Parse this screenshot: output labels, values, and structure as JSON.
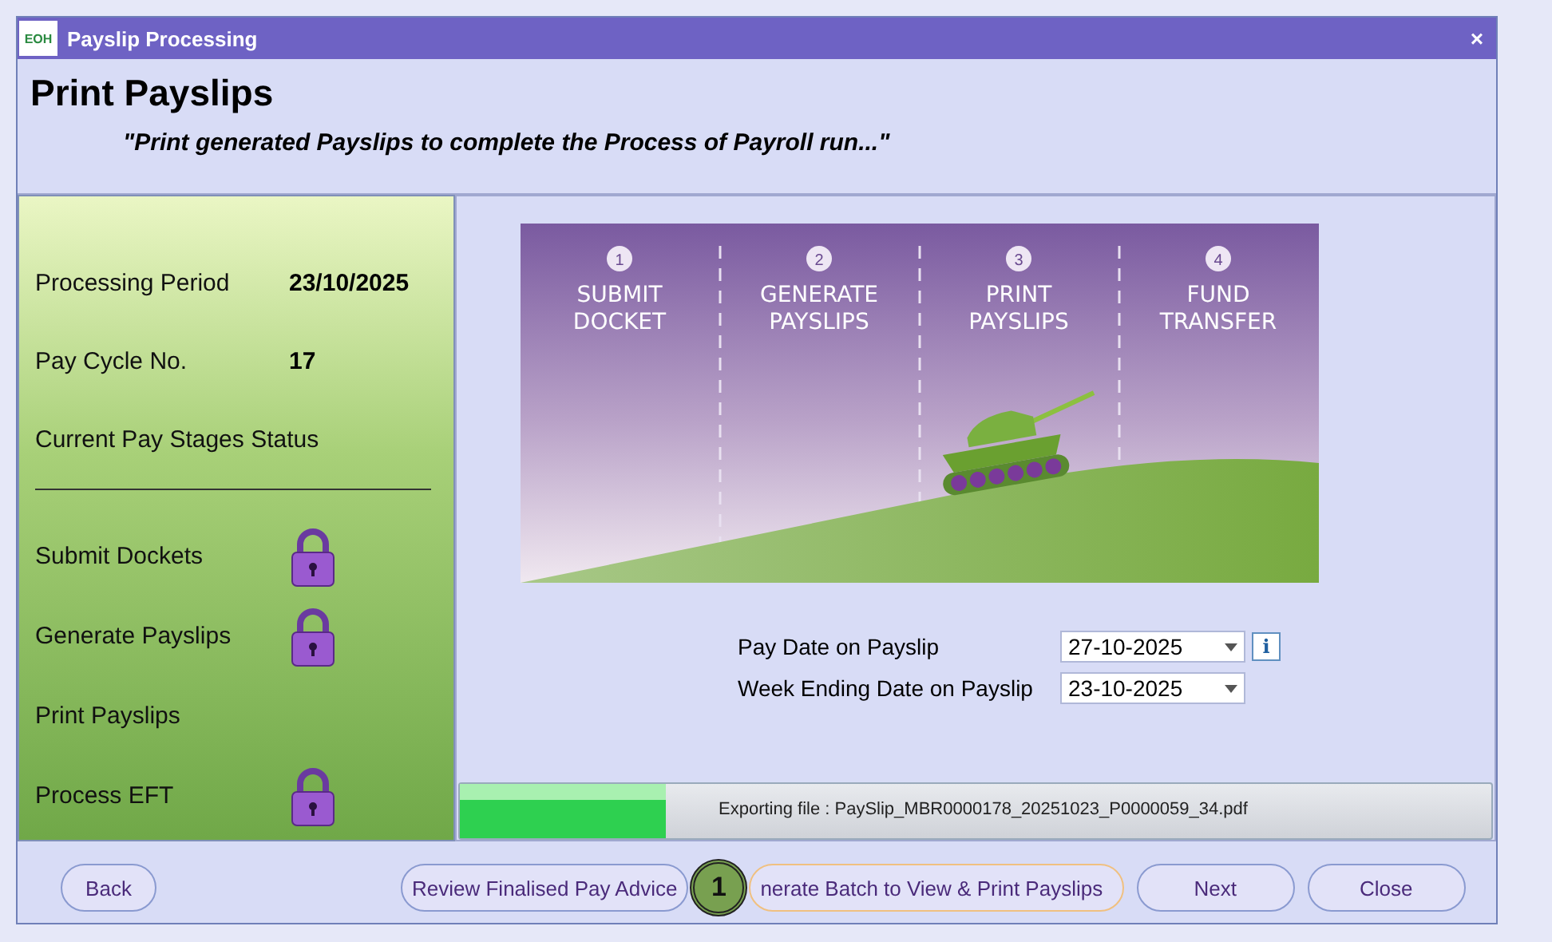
{
  "window": {
    "title": "Payslip Processing",
    "logo": "EOH",
    "close": "×"
  },
  "header": {
    "title": "Print Payslips",
    "subtitle": "\"Print generated Payslips to complete the Process of Payroll run...\""
  },
  "summary": [
    {
      "label": "Processing Period",
      "value": "23/10/2025"
    },
    {
      "label": "Pay Cycle No.",
      "value": "17"
    }
  ],
  "status_heading": "Current Pay Stages Status",
  "stages": [
    {
      "label": "Submit Dockets",
      "locked": true
    },
    {
      "label": "Generate Payslips",
      "locked": true
    },
    {
      "label": "Print Payslips",
      "locked": false
    },
    {
      "label": "Process EFT",
      "locked": true
    }
  ],
  "steps": [
    {
      "number": "1",
      "lines": [
        "SUBMIT",
        "DOCKET"
      ]
    },
    {
      "number": "2",
      "lines": [
        "GENERATE",
        "PAYSLIPS"
      ]
    },
    {
      "number": "3",
      "lines": [
        "PRINT",
        "PAYSLIPS"
      ]
    },
    {
      "number": "4",
      "lines": [
        "FUND",
        "TRANSFER"
      ]
    }
  ],
  "fields": [
    {
      "label": "Pay Date on Payslip",
      "value": "27-10-2025",
      "info": true,
      "info_label": "i"
    },
    {
      "label": "Week Ending Date on Payslip",
      "value": "23-10-2025",
      "info": false
    }
  ],
  "progress": {
    "level": 0.2,
    "message": "Exporting file : PaySlip_MBR0000178_20251023_P0000059_34.pdf"
  },
  "buttons": [
    {
      "label": "Back",
      "kind": "plain"
    },
    {
      "label": "Review Finalised Pay Advice",
      "kind": "plain"
    },
    {
      "label": "nerate Batch to View & Print Payslips",
      "kind": "highlighted",
      "badge": "1"
    },
    {
      "label": "Next",
      "kind": "plain"
    },
    {
      "label": "Close",
      "kind": "plain"
    }
  ]
}
